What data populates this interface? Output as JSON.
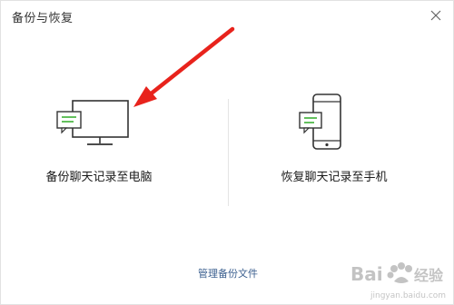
{
  "window": {
    "title": "备份与恢复"
  },
  "options": {
    "backup": {
      "label": "备份聊天记录至电脑",
      "icon": "monitor-chat-icon"
    },
    "restore": {
      "label": "恢复聊天记录至手机",
      "icon": "phone-chat-icon"
    }
  },
  "footer": {
    "manage_label": "管理备份文件"
  },
  "colors": {
    "accent_green": "#3cb034",
    "link_blue": "#3b5f8f",
    "arrow_red": "#e8231c"
  },
  "watermark": {
    "text_main": "Bai",
    "text_sub": "jingyan.baidu.com"
  }
}
